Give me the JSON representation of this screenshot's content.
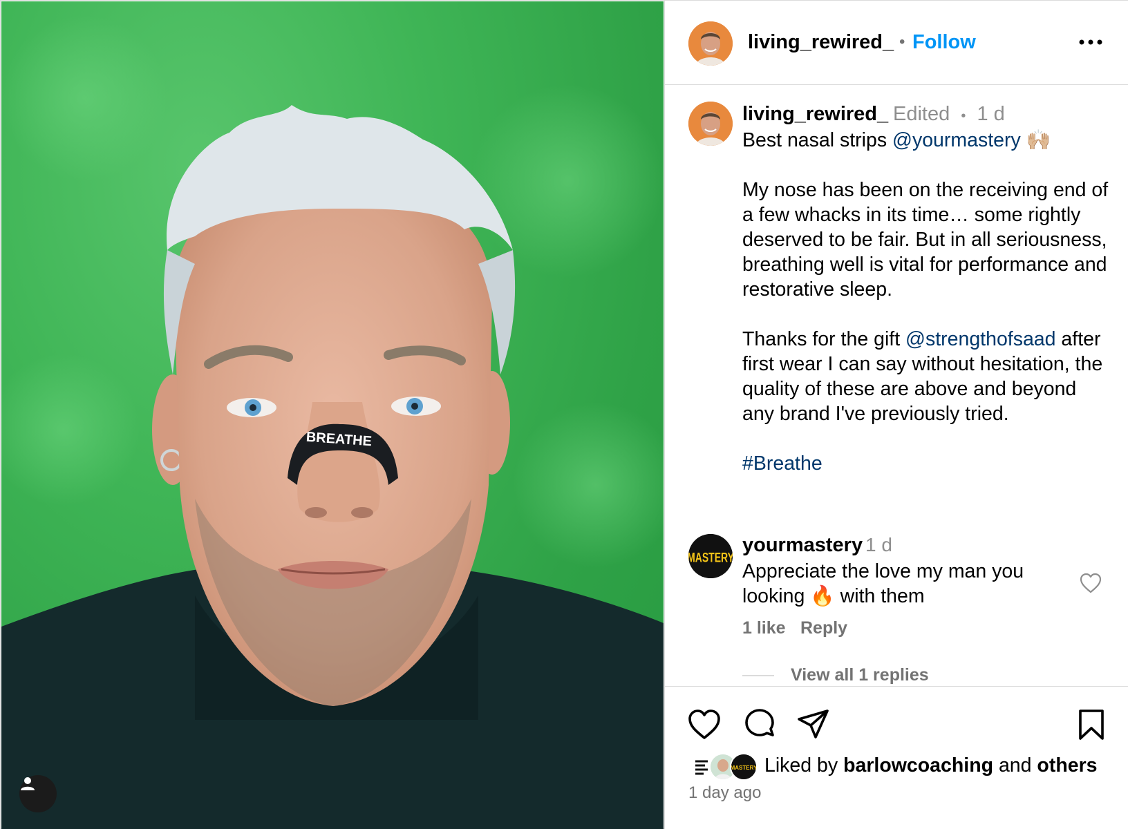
{
  "post": {
    "author": "living_rewired_",
    "follow_label": "Follow",
    "separator": "•"
  },
  "photo": {
    "strip_text": "BREATHE",
    "tag_icon": "user-icon"
  },
  "caption": {
    "username": "living_rewired_",
    "edited": "Edited",
    "separator": "•",
    "time": "1 d",
    "line1_text": "Best nasal strips ",
    "line1_mention": "@yourmastery",
    "line1_emoji": "🙌🏼",
    "para2": "My nose has been on the receiving end of a few whacks in its time… some rightly deserved to be fair. But in all seriousness, breathing well is vital for performance and restorative sleep.",
    "para3_prefix": "Thanks for the gift ",
    "para3_mention": "@strengthofsaad",
    "para3_rest": " after first wear I can say without hesitation, the quality of these are above and beyond any brand I've previously tried.",
    "hashtag": "#Breathe"
  },
  "comment": {
    "username": "yourmastery",
    "avatar_text": "MASTERY",
    "time": "1 d",
    "text_before": "Appreciate the love my man you looking ",
    "emoji": "🔥",
    "text_after": " with them",
    "likes": "1 like",
    "reply_label": "Reply",
    "view_replies": "View all 1 replies"
  },
  "actions": {
    "icons": [
      "heart-icon",
      "comment-icon",
      "share-icon",
      "bookmark-icon"
    ],
    "liked_by_prefix": "Liked by ",
    "liked_by_user": "barlowcoaching",
    "liked_by_mid": " and ",
    "liked_by_others": "others",
    "mini_avatar_text": "MASTERY",
    "time_ago": "1 day ago"
  },
  "colors": {
    "follow_blue": "#0095f6",
    "mention": "#00376b",
    "secondary_text": "#737373",
    "grass_green": "#3fb556",
    "avatar_orange": "#e8893d"
  }
}
